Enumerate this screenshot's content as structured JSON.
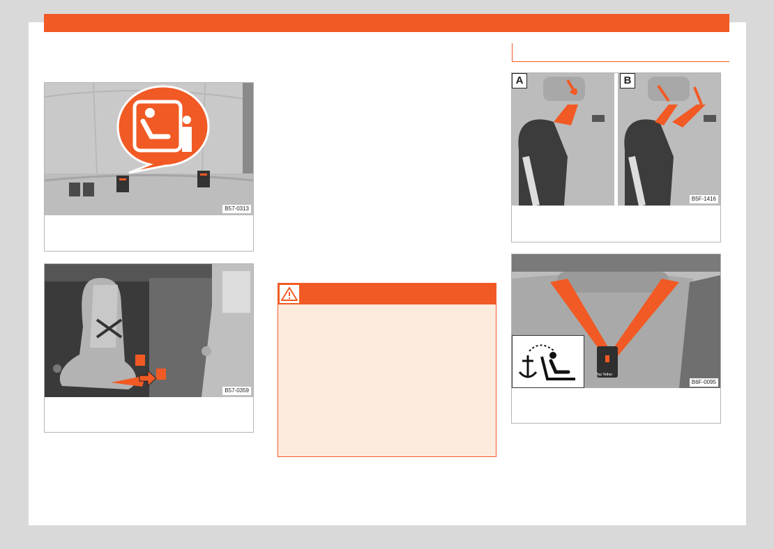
{
  "colors": {
    "accent": "#f15a24",
    "warning_bg": "#fdebde",
    "page": "#ffffff",
    "outer": "#d9d9d9"
  },
  "figures": {
    "isofix_symbol": {
      "code": "B57-0313",
      "icon": "isofix-child-seat-info-icon"
    },
    "isofix_install": {
      "code": "B57-0359"
    },
    "top_tether_routing": {
      "code": "B5F-1416",
      "panels": [
        "A",
        "B"
      ]
    },
    "top_tether_anchor": {
      "code": "B6F-0095",
      "anchor_label": "Top Tether",
      "icon": "top-tether-anchor-icon"
    }
  },
  "warning": {
    "icon": "warning-triangle-icon"
  }
}
